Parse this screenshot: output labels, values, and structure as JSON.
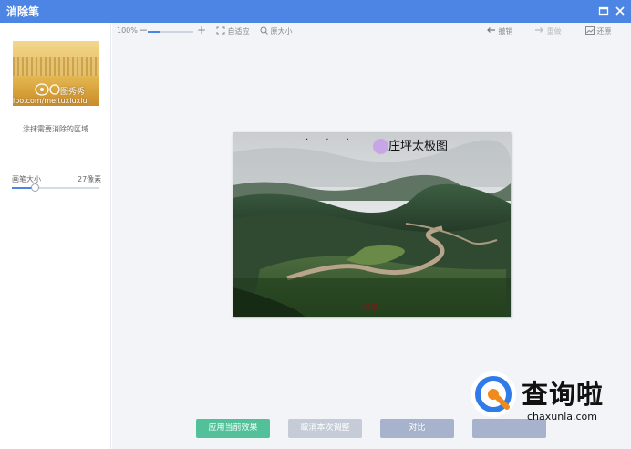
{
  "window": {
    "title": "消除笔"
  },
  "sidebar": {
    "thumbnail": {
      "watermark_url": "ibo.com/meituxiuxiu",
      "watermark_brand": "图秀秀"
    },
    "hint": "涂抹需要消除的区域",
    "brush": {
      "label": "画笔大小",
      "value_text": "27像素",
      "level": 0.28
    }
  },
  "toolbar": {
    "zoom_percent": "100%",
    "zoom_minus": "−",
    "zoom_plus": "+",
    "zoom_level": 0.25,
    "fit": "自适应",
    "original": "原大小",
    "undo": "撤销",
    "redo": "重做",
    "restore": "还原"
  },
  "photo": {
    "caption": "庄坪太极图",
    "stamp": "印章"
  },
  "buttons": {
    "apply": "应用当前效果",
    "cancel": "取消本次调整",
    "compare": "对比"
  },
  "logo": {
    "name": "查询啦",
    "url": "chaxunla.com"
  },
  "colors": {
    "titlebar": "#4c85e3",
    "apply": "#52c19a",
    "accent": "#4c85e3",
    "logo_blue": "#2f7be8",
    "logo_orange": "#f08a1c"
  },
  "icons": {
    "maximize": "maximize-icon",
    "close": "close-icon",
    "fit": "fit-icon",
    "original": "magnifier-icon",
    "undo": "undo-arrow-icon",
    "redo": "redo-arrow-icon",
    "restore": "image-icon"
  }
}
